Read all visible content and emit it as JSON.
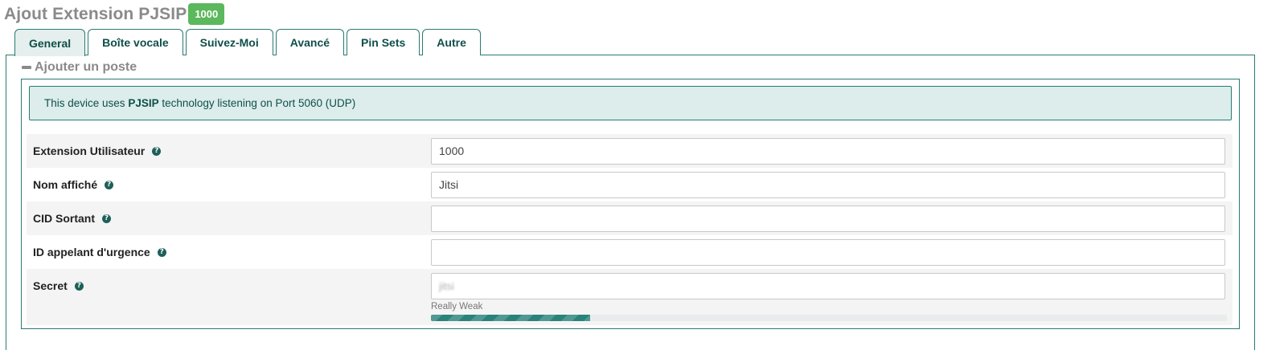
{
  "header": {
    "title": "Ajout Extension PJSIP",
    "extension_badge": "1000"
  },
  "tabs": [
    {
      "label": "General",
      "active": true
    },
    {
      "label": "Boîte vocale",
      "active": false
    },
    {
      "label": "Suivez-Moi",
      "active": false
    },
    {
      "label": "Avancé",
      "active": false
    },
    {
      "label": "Pin Sets",
      "active": false
    },
    {
      "label": "Autre",
      "active": false
    }
  ],
  "section": {
    "title": "Ajouter un poste",
    "collapse_icon": "minus-icon"
  },
  "alert": {
    "prefix": "This device uses ",
    "technology": "PJSIP",
    "suffix": " technology listening on Port 5060 (UDP)"
  },
  "fields": [
    {
      "label": "Extension Utilisateur",
      "value": "1000",
      "placeholder": ""
    },
    {
      "label": "Nom affiché",
      "value": "Jitsi",
      "placeholder": ""
    },
    {
      "label": "CID Sortant",
      "value": "",
      "placeholder": ""
    },
    {
      "label": "ID appelant d'urgence",
      "value": "",
      "placeholder": ""
    },
    {
      "label": "Secret",
      "value": "jitsi",
      "placeholder": ""
    }
  ],
  "help_icon": "question-circle-icon",
  "help_glyph": "?",
  "password_strength": {
    "label": "Really Weak",
    "fill_fraction": 0.2
  },
  "colors": {
    "accent": "#2a7a72",
    "badge": "#5cb85c",
    "alert_bg": "#dcedec"
  }
}
